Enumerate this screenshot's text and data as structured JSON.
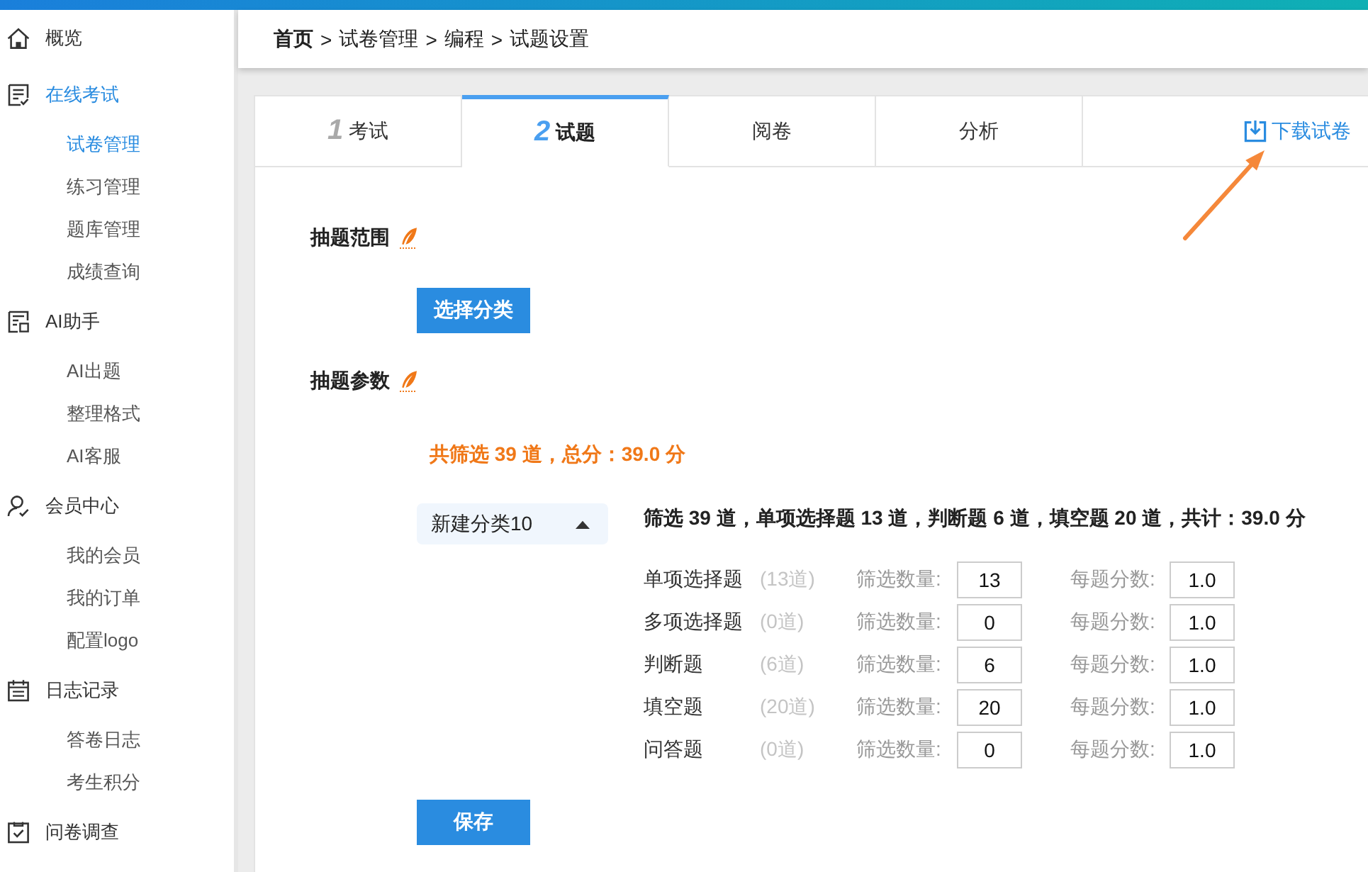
{
  "sidebar": {
    "items": [
      {
        "label": "概览",
        "selected": false
      },
      {
        "label": "在线考试",
        "selected": true,
        "children": [
          {
            "label": "试卷管理",
            "selected": true
          },
          {
            "label": "练习管理",
            "selected": false
          },
          {
            "label": "题库管理",
            "selected": false
          },
          {
            "label": "成绩查询",
            "selected": false
          }
        ]
      },
      {
        "label": "AI助手",
        "selected": false,
        "children": [
          {
            "label": "AI出题",
            "selected": false
          },
          {
            "label": "整理格式",
            "selected": false
          },
          {
            "label": "AI客服",
            "selected": false
          }
        ]
      },
      {
        "label": "会员中心",
        "selected": false,
        "children": [
          {
            "label": "我的会员",
            "selected": false
          },
          {
            "label": "我的订单",
            "selected": false
          },
          {
            "label": "配置logo",
            "selected": false
          }
        ]
      },
      {
        "label": "日志记录",
        "selected": false,
        "children": [
          {
            "label": "答卷日志",
            "selected": false
          },
          {
            "label": "考生积分",
            "selected": false
          }
        ]
      },
      {
        "label": "问卷调查",
        "selected": false
      }
    ]
  },
  "breadcrumb": [
    {
      "kind": "home",
      "text": "首页"
    },
    {
      "kind": "separator",
      "text": ">"
    },
    {
      "kind": "link",
      "text": "试卷管理"
    },
    {
      "kind": "separator",
      "text": ">"
    },
    {
      "kind": "link",
      "text": "编程"
    },
    {
      "kind": "separator",
      "text": ">"
    },
    {
      "kind": "link",
      "text": "试题设置"
    }
  ],
  "tabs": [
    {
      "number": "1",
      "label": "考试",
      "selected": false
    },
    {
      "number": "2",
      "label": "试题",
      "selected": true
    },
    {
      "label": "阅卷",
      "selected": false
    },
    {
      "label": "分析",
      "selected": false
    }
  ],
  "download_link": {
    "label": "下载试卷"
  },
  "range_section": {
    "title": "抽题范围",
    "button": "选择分类"
  },
  "params_section": {
    "title": "抽题参数",
    "summary": "共筛选 39 道，总分：39.0 分",
    "category": {
      "label": "新建分类10",
      "expanded": true
    },
    "category_summary": "筛选 39 道，单项选择题 13 道，判断题 6 道，填空题 20 道，共计：39.0 分",
    "rows": [
      {
        "type": "单项选择题",
        "available": "(13道)",
        "count_label": "筛选数量:",
        "count": "13",
        "score_label": "每题分数:",
        "score": "1.0"
      },
      {
        "type": "多项选择题",
        "available": "(0道)",
        "count_label": "筛选数量:",
        "count": "0",
        "score_label": "每题分数:",
        "score": "1.0"
      },
      {
        "type": "判断题",
        "available": "(6道)",
        "count_label": "筛选数量:",
        "count": "6",
        "score_label": "每题分数:",
        "score": "1.0"
      },
      {
        "type": "填空题",
        "available": "(20道)",
        "count_label": "筛选数量:",
        "count": "20",
        "score_label": "每题分数:",
        "score": "1.0"
      },
      {
        "type": "问答题",
        "available": "(0道)",
        "count_label": "筛选数量:",
        "count": "0",
        "score_label": "每题分数:",
        "score": "1.0"
      }
    ]
  },
  "save_button": "保存"
}
